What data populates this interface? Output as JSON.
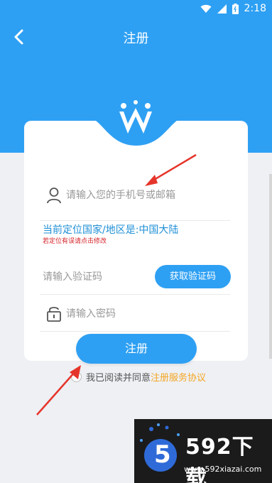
{
  "status_bar": {
    "time": "2:18"
  },
  "header": {
    "title": "注册"
  },
  "form": {
    "account_placeholder": "请输入您的手机号或邮箱",
    "region_text": "当前定位国家/地区是:中国大陆",
    "region_hint": "若定位有误请点击修改",
    "code_placeholder": "请输入验证码",
    "get_code_label": "获取验证码",
    "password_placeholder": "请输入密码",
    "register_label": "注册"
  },
  "agreement": {
    "text": "我已阅读并同意",
    "link": "注册服务协议"
  },
  "watermark": {
    "title": "592下载",
    "url": "www.592xiazai.com",
    "logo": "5"
  },
  "colors": {
    "primary": "#2ea0f3",
    "link": "#f5a623",
    "hint": "#d4242a",
    "annotation": "#e5352b"
  }
}
